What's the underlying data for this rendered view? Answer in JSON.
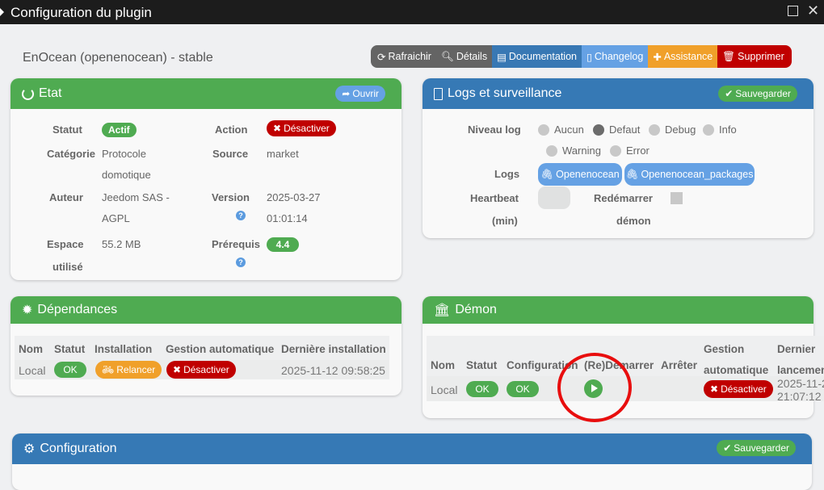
{
  "window": {
    "title": "Configuration du plugin"
  },
  "subtitle": "EnOcean (openenocean) - stable",
  "toolbar": [
    {
      "label": "Rafraichir",
      "icon": "refresh-icon",
      "color": "#646464"
    },
    {
      "label": "Détails",
      "icon": "search-icon",
      "color": "#646464"
    },
    {
      "label": "Documentation",
      "icon": "book-icon",
      "color": "#3878b4"
    },
    {
      "label": "Changelog",
      "icon": "file-code-icon",
      "color": "#65a1e4"
    },
    {
      "label": "Assistance",
      "icon": "ambulance-icon",
      "color": "#f0a02a"
    },
    {
      "label": "Supprimer",
      "icon": "trash-icon",
      "color": "#c00000"
    }
  ],
  "etat": {
    "title": "Etat",
    "open_label": "Ouvrir",
    "statut_label": "Statut",
    "statut": "Actif",
    "action_label": "Action",
    "action": "Désactiver",
    "categorie_label": "Catégorie",
    "categorie_1": "Protocole",
    "categorie_2": "domotique",
    "source_label": "Source",
    "source": "market",
    "auteur_label": "Auteur",
    "auteur_1": "Jeedom SAS -",
    "auteur_2": "AGPL",
    "version_label": "Version",
    "version_1": "2025-03-27",
    "version_2": "01:01:14",
    "espace_label_1": "Espace",
    "espace_label_2": "utilisé",
    "espace": "55.2 MB",
    "prerequis_label": "Prérequis",
    "prerequis": "4.4"
  },
  "logs": {
    "title": "Logs et surveillance",
    "save_label": "Sauvegarder",
    "niveau_label": "Niveau log",
    "levels": [
      "Aucun",
      "Defaut",
      "Debug",
      "Info",
      "Warning",
      "Error"
    ],
    "selected": "Defaut",
    "logs_label": "Logs",
    "log_buttons": [
      "Openenocean",
      "Openenocean_packages"
    ],
    "heartbeat_label_1": "Heartbeat",
    "heartbeat_label_2": "(min)",
    "heartbeat_value": "",
    "restart_label_1": "Redémarrer",
    "restart_label_2": "démon"
  },
  "deps": {
    "title": "Dépendances",
    "headers": [
      "Nom",
      "Statut",
      "Installation",
      "Gestion automatique",
      "Dernière installation"
    ],
    "row": {
      "nom": "Local",
      "statut": "OK",
      "installation": "Relancer",
      "gestion": "Désactiver",
      "date": "2025-11-12 09:58:25"
    }
  },
  "demon": {
    "title": "Démon",
    "headers": [
      "Nom",
      "Statut",
      "Configuration",
      "(Re)Demarrer",
      "Arrêter",
      "Gestion",
      "automatique",
      "Dernier",
      "lancemen"
    ],
    "row": {
      "nom": "Local",
      "statut": "OK",
      "configuration": "OK",
      "gestion": "Désactiver",
      "date_1": "2025-11-2",
      "date_2": "21:07:12"
    }
  },
  "config": {
    "title": "Configuration",
    "save_label": "Sauvegarder"
  }
}
